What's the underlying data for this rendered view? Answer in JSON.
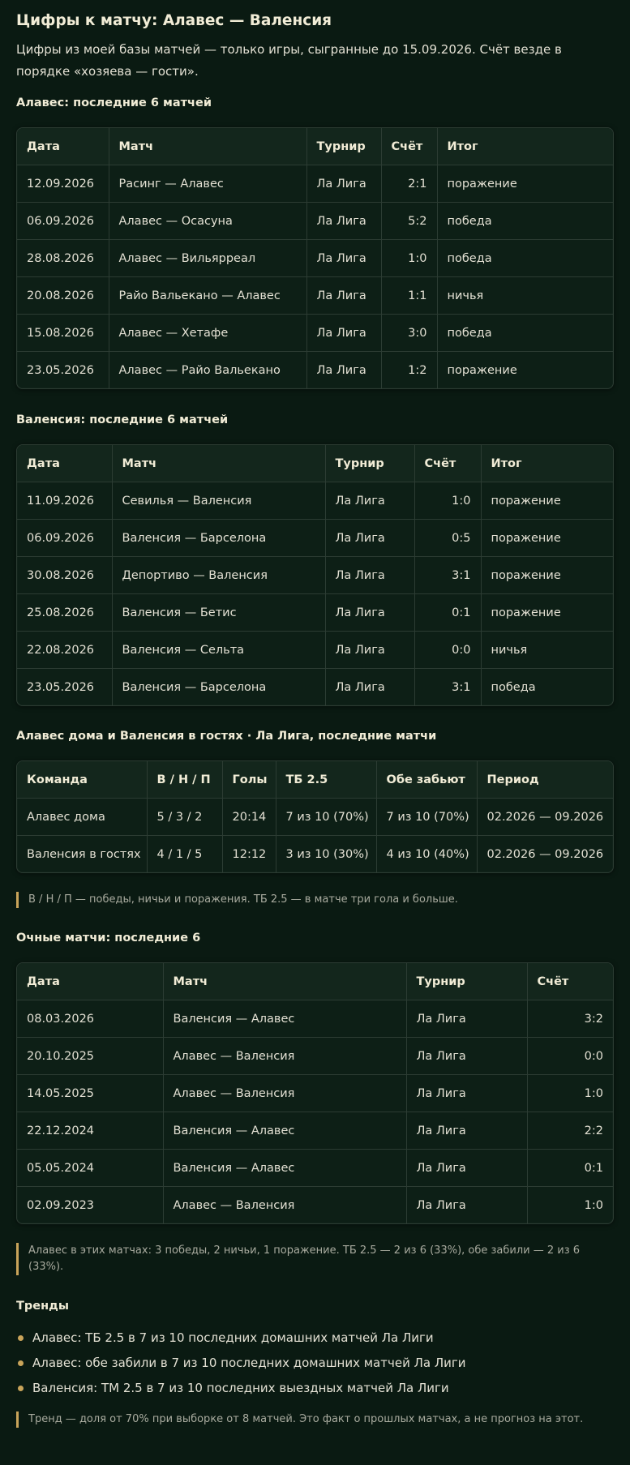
{
  "title": "Цифры к матчу: Алавес — Валенсия",
  "intro": "Цифры из моей базы матчей — только игры, сыгранные до 15.09.2026. Счёт везде в порядке «хозяева — гости».",
  "alaves_recent": {
    "heading": "Алавес: последние 6 матчей",
    "headers": [
      "Дата",
      "Матч",
      "Турнир",
      "Счёт",
      "Итог"
    ],
    "rows": [
      [
        "12.09.2026",
        "Расинг — Алавес",
        "Ла Лига",
        "2:1",
        "поражение"
      ],
      [
        "06.09.2026",
        "Алавес — Осасуна",
        "Ла Лига",
        "5:2",
        "победа"
      ],
      [
        "28.08.2026",
        "Алавес — Вильярреал",
        "Ла Лига",
        "1:0",
        "победа"
      ],
      [
        "20.08.2026",
        "Райо Вальекано — Алавес",
        "Ла Лига",
        "1:1",
        "ничья"
      ],
      [
        "15.08.2026",
        "Алавес — Хетафе",
        "Ла Лига",
        "3:0",
        "победа"
      ],
      [
        "23.05.2026",
        "Алавес — Райо Вальекано",
        "Ла Лига",
        "1:2",
        "поражение"
      ]
    ]
  },
  "valencia_recent": {
    "heading": "Валенсия: последние 6 матчей",
    "headers": [
      "Дата",
      "Матч",
      "Турнир",
      "Счёт",
      "Итог"
    ],
    "rows": [
      [
        "11.09.2026",
        "Севилья — Валенсия",
        "Ла Лига",
        "1:0",
        "поражение"
      ],
      [
        "06.09.2026",
        "Валенсия — Барселона",
        "Ла Лига",
        "0:5",
        "поражение"
      ],
      [
        "30.08.2026",
        "Депортиво — Валенсия",
        "Ла Лига",
        "3:1",
        "поражение"
      ],
      [
        "25.08.2026",
        "Валенсия — Бетис",
        "Ла Лига",
        "0:1",
        "поражение"
      ],
      [
        "22.08.2026",
        "Валенсия — Сельта",
        "Ла Лига",
        "0:0",
        "ничья"
      ],
      [
        "23.05.2026",
        "Валенсия — Барселона",
        "Ла Лига",
        "3:1",
        "победа"
      ]
    ]
  },
  "home_away": {
    "heading": "Алавес дома и Валенсия в гостях · Ла Лига, последние матчи",
    "headers": [
      "Команда",
      "В / Н / П",
      "Голы",
      "ТБ 2.5",
      "Обе забьют",
      "Период"
    ],
    "rows": [
      [
        "Алавес дома",
        "5 / 3 / 2",
        "20:14",
        "7 из 10 (70%)",
        "7 из 10 (70%)",
        "02.2026 — 09.2026"
      ],
      [
        "Валенсия в гостях",
        "4 / 1 / 5",
        "12:12",
        "3 из 10 (30%)",
        "4 из 10 (40%)",
        "02.2026 — 09.2026"
      ]
    ],
    "note": "В / Н / П — победы, ничьи и поражения. ТБ 2.5 — в матче три гола и больше."
  },
  "h2h": {
    "heading": "Очные матчи: последние 6",
    "headers": [
      "Дата",
      "Матч",
      "Турнир",
      "Счёт"
    ],
    "rows": [
      [
        "08.03.2026",
        "Валенсия — Алавес",
        "Ла Лига",
        "3:2"
      ],
      [
        "20.10.2025",
        "Алавес — Валенсия",
        "Ла Лига",
        "0:0"
      ],
      [
        "14.05.2025",
        "Алавес — Валенсия",
        "Ла Лига",
        "1:0"
      ],
      [
        "22.12.2024",
        "Валенсия — Алавес",
        "Ла Лига",
        "2:2"
      ],
      [
        "05.05.2024",
        "Валенсия — Алавес",
        "Ла Лига",
        "0:1"
      ],
      [
        "02.09.2023",
        "Алавес — Валенсия",
        "Ла Лига",
        "1:0"
      ]
    ],
    "note": "Алавес в этих матчах: 3 победы, 2 ничьи, 1 поражение. ТБ 2.5 — 2 из 6 (33%), обе забили — 2 из 6 (33%)."
  },
  "trends": {
    "heading": "Тренды",
    "items": [
      "Алавес: ТБ 2.5 в 7 из 10 последних домашних матчей Ла Лиги",
      "Алавес: обе забили в 7 из 10 последних домашних матчей Ла Лиги",
      "Валенсия: ТМ 2.5 в 7 из 10 последних выездных матчей Ла Лиги"
    ],
    "note": "Тренд — доля от 70% при выборке от 8 матчей. Это факт о прошлых матчах, а не прогноз на этот."
  },
  "colors": {
    "background": "#0a1a12",
    "accent": "#c9a45a",
    "text": "#e3e0d3"
  }
}
